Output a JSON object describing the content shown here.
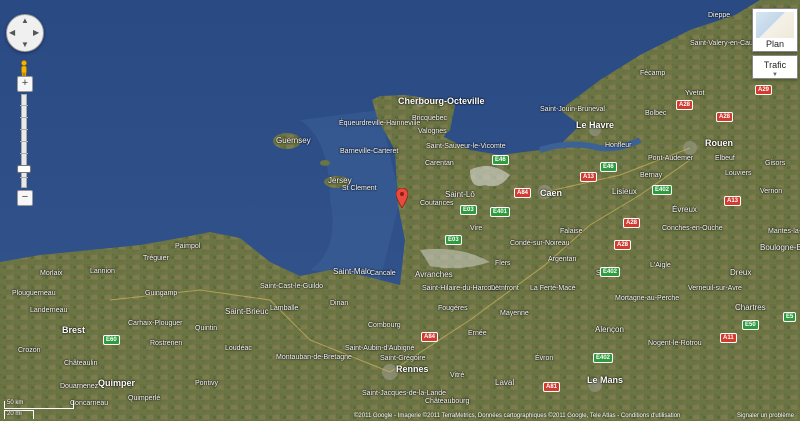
{
  "controls": {
    "pan": {
      "up": "▲",
      "down": "▼",
      "left": "◀",
      "right": "▶"
    },
    "zoom": {
      "in": "+",
      "out": "−"
    },
    "map_type": {
      "label": "Plan"
    },
    "layers": {
      "label": "Trafic"
    }
  },
  "scale": {
    "km": "50 km",
    "mi": "20 mi"
  },
  "footer": {
    "copyright": "©2011 Google - Imagerie ©2011 TerraMetrics, Données cartographiques ©2011 Google, Tele Atlas - Conditions d'utilisation",
    "report": "Signaler un problème"
  },
  "map": {
    "type": "satellite",
    "cities": {
      "cherbourg": "Cherbourg-Octeville",
      "le_havre": "Le Havre",
      "caen": "Caen",
      "rouen": "Rouen",
      "saint_malo": "Saint-Malo",
      "saint_brieuc": "Saint-Brieuc",
      "brest": "Brest",
      "quimper": "Quimper",
      "rennes": "Rennes",
      "le_mans": "Le Mans",
      "laval": "Laval",
      "evreux": "Évreux",
      "dreux": "Dreux",
      "chartres": "Chartres",
      "alencon": "Alençon",
      "lisieux": "Lisieux",
      "saint_lo": "Saint-Lô",
      "avranches": "Avranches",
      "guernsey": "Guernsey",
      "jersey": "Jersey",
      "granville": "Granville",
      "dieppe": "Dieppe",
      "bayeux": "Bayeux",
      "cancale": "Cancale",
      "dinan": "Dinan",
      "fougeres": "Fougères",
      "mayenne": "Mayenne",
      "flers": "Flers",
      "argentan": "Argentan",
      "vire": "Vire",
      "coutances": "Coutances",
      "carentan": "Carentan",
      "valognes": "Valognes",
      "barneville": "Barneville-Carteret",
      "bernay": "Bernay",
      "honfleur": "Honfleur",
      "pont_audemer": "Pont-Audemer",
      "yvetot": "Yvetot",
      "fecamp": "Fécamp",
      "bolbec": "Bolbec",
      "vitre": "Vitré",
      "lamballe": "Lamballe",
      "guingamp": "Guingamp",
      "morlaix": "Morlaix",
      "lannion": "Lannion",
      "loudeac": "Loudéac",
      "pontivy": "Pontivy",
      "carhaix": "Carhaix-Plouguer",
      "chateaulin": "Châteaulin",
      "douarnenez": "Douarnenez",
      "landerneau": "Landerneau",
      "combourg": "Combourg",
      "montfort": "Montfort-sur-Meu",
      "saint_meen": "Saint-Méen-le-Grand",
      "mortagne": "Mortagne-au-Perche",
      "nogent": "Nogent-le-Rotrou",
      "verneuil": "Verneuil-sur-Avre",
      "louviers": "Louviers",
      "elbeuf": "Elbeuf",
      "gisors": "Gisors",
      "vernon": "Vernon",
      "mantes": "Mantes-la-Jolie",
      "boulogne": "Boulogne-Billancourt",
      "rambouillet": "Rambouillet",
      "conches": "Conches-en-Ouche",
      "laigle": "L'Aigle",
      "sees": "Sées",
      "falaise": "Falaise",
      "domfront": "Domfront",
      "la_ferte_mace": "La Ferté-Macé",
      "ernee": "Ernée",
      "evron": "Évron",
      "sille": "Sillé-le-Guillaume",
      "mamers": "Mamers",
      "la_ferte_bernard": "La Ferté-Bernard",
      "chateaudun": "Châteaudun",
      "saint_gregoire": "Saint-Grégoire",
      "cesson": "Cesson-Sévigné",
      "bruz": "Bruz",
      "janze": "Janzé",
      "craon": "Craon",
      "sable": "Sablé-sur-Sarthe",
      "la_fleche": "La Flèche",
      "saint_calais": "Saint-Calais",
      "vendome": "Vendôme",
      "quimperle": "Quimperlé",
      "concarneau": "Concarneau",
      "plouguerneau": "Plouguerneau",
      "paimpol": "Paimpol",
      "perros": "Perros-Guirec",
      "treguier": "Tréguier",
      "saint_pol": "Saint-Pol-de-Léon",
      "roscoff": "Roscoff",
      "dinard": "Dinard",
      "saint_cast": "Saint-Cast-le-Guildo",
      "erquy": "Erquy",
      "pleneuf": "Pléneuf-Val-André",
      "saint_quay": "Saint-Quay-Portrieux",
      "bricquebec": "Bricquebec",
      "les_pieux": "Les Pieux",
      "saint_clement": "St Clement",
      "st_helier": "St Helier",
      "tourlaville": "Tourlaville",
      "equeurdreville": "Équeurdreville-Hainneville",
      "saint_sauveur": "Saint-Sauveur-le-Vicomte",
      "lessay": "Lessay",
      "periers": "Périers",
      "villedieu": "Villedieu-les-Poêles",
      "conde": "Condé-sur-Noireau",
      "pont_l_eveque": "Pont-l'Évêque",
      "saint_valery": "Saint-Valery-en-Caux",
      "saint_romain": "Saint-Romain-de-Colbosc",
      "le_neubourg": "Le Neubourg",
      "barentin": "Barentin",
      "montivilliers": "Montivilliers",
      "saint_aubin": "Saint-Aubin-d'Aubigné",
      "montauban": "Montauban-de-Bretagne",
      "quintin": "Quintin",
      "rostrenen": "Rostrenen",
      "uzel": "Uzel",
      "chateaubourg": "Châteaubourg",
      "mordelles": "Mordelles",
      "saint_jacques": "Saint-Jacques-de-la-Lande",
      "vitre2": "La Guerche-de-Bretagne",
      "ballon": "Ballon",
      "bonnetable": "Bonnétable",
      "mer": "Meslay-du-Maine",
      "laval2": "Château-Gontier",
      "crozon": "Crozon",
      "plabennec": "Plabennec",
      "landivisiau": "Landivisiau",
      "lesneven": "Lesneven",
      "guipavas": "Guipavas",
      "plougastel": "Plougastel-Daoulas",
      "chateauneuf": "Châteauneuf-du-Faou",
      "pleyben": "Pleyben",
      "huelgoat": "Huelgoat",
      "plouaret": "Plouaret",
      "belle_isle": "Belle-Isle-en-Terre",
      "callac": "Callac",
      "broons": "Broons",
      "plancoet": "Plancoët",
      "jugon": "Jugon-les-Lacs",
      "tinteniac": "Tinténiac",
      "liffre": "Liffré",
      "saint_aubin_cormier": "Saint-Aubin-du-Cormier",
      "louvigne": "Louvigné-du-Désert",
      "saint_hilaire": "Saint-Hilaire-du-Harcouët",
      "mortain": "Mortain",
      "pontorson": "Pontorson",
      "ducey": "Ducey",
      "torigni": "Torigni-sur-Vire",
      "caumont": "Caumont-l'Éventé",
      "villers": "Villers-Bocage",
      "aunay": "Aunay-sur-Odon",
      "thury": "Thury-Harcourt",
      "dives": "Dives-sur-Mer",
      "cabourg": "Cabourg",
      "trouville": "Trouville-sur-Mer",
      "deauville": "Deauville",
      "livarot": "Livarot",
      "vimoutiers": "Vimoutiers",
      "orbec": "Orbec",
      "gace": "Gacé",
      "ecouche": "Écouché",
      "carrouges": "Carrouges",
      "pre_en_pail": "Pré-en-Pail",
      "bagnoles": "Bagnoles-de-l'Orne",
      "tinchebray": "Tinchebray",
      "saint_pois": "Saint-Pois",
      "gavray": "Gavray",
      "brehal": "Bréhal",
      "montmartin": "Montmartin-sur-Mer",
      "agon": "Agon-Coutainville",
      "canisy": "Canisy",
      "marigny": "Marigny",
      "isigny": "Isigny-sur-Mer",
      "sainte_mere": "Sainte-Mère-Église",
      "montebourg": "Montebourg",
      "saint_vaast": "Saint-Vaast-la-Hougue",
      "barfleur": "Barfleur",
      "saint_pierre": "Saint-Pierre-Église",
      "beaumont": "Beaumont-Hague",
      "flamanville": "Flamanville",
      "portbail": "Portbail",
      "la_haye": "La Haye-du-Puits",
      "sottevast": "Sottevast",
      "lisieux2": "Saint-Pierre-sur-Dives",
      "mezidon": "Mézidon-Canon",
      "troarn": "Troarn",
      "ouistreham": "Ouistreham",
      "courseulles": "Courseulles-sur-Mer",
      "douvres": "Douvres-la-Délivrande",
      "tilly": "Tilly-sur-Seulles",
      "evrecy": "Évrecy",
      "bretteville": "Bretteville-sur-Laize",
      "cintheaux": "Cintheaux",
      "potigny": "Potigny",
      "trun": "Trun",
      "chambois": "Chambois",
      "le_merlerault": "Le Merlerault",
      "courtomer": "Courtomer",
      "le_mele": "Le Mêle-sur-Sarthe",
      "belleme": "Bellême",
      "remalard": "Rémalard",
      "longny": "Longny-au-Perche",
      "moulins": "Moulins-la-Marche",
      "breteuil": "Breteuil",
      "damville": "Damville",
      "saint_andre": "Saint-André-de-l'Eure",
      "pacy": "Pacy-sur-Eure",
      "anet": "Anet",
      "ivry": "Ivry-la-Bataille",
      "nonancourt": "Nonancourt",
      "brezolles": "Brezolles",
      "senonches": "Senonches",
      "chateauneuf_thymerais": "Châteauneuf-en-Thymerais",
      "la_loupe": "La Loupe",
      "courville": "Courville-sur-Eure",
      "illiers": "Illiers-Combray",
      "bonneval": "Bonneval",
      "voves": "Voves",
      "auneau": "Auneau",
      "maintenon": "Maintenon",
      "epernon": "Épernon",
      "nogent_roi": "Nogent-le-Roi",
      "houdan": "Houdan",
      "septeuil": "Septeuil",
      "bonnieres": "Bonnières-sur-Seine",
      "magny": "Magny-en-Vexin",
      "etrepagny": "Étrépagny",
      "lyons": "Lyons-la-Forêt",
      "fleury": "Fleury-sur-Andelle",
      "les_andelys": "Les Andelys",
      "gaillon": "Gaillon",
      "val_de_reuil": "Val-de-Reuil",
      "pont_de_l_arche": "Pont-de-l'Arche",
      "bourgtheroulde": "Bourgtheroulde-Infreville",
      "routot": "Routot",
      "bourg_achard": "Bourg-Achard",
      "brionne": "Brionne",
      "beaumont_le_roger": "Beaumont-le-Roger",
      "broglie": "Broglie",
      "thiberville": "Thiberville",
      "cormeilles": "Cormeilles",
      "beuzeville": "Beuzeville",
      "quillebeuf": "Quillebeuf-sur-Seine",
      "lillebonne": "Lillebonne",
      "caudebec": "Caudebec-en-Caux",
      "duclair": "Duclair",
      "maromme": "Maromme",
      "mont_saint_aignan": "Mont-Saint-Aignan",
      "bois_guillaume": "Bois-Guillaume",
      "darnetal": "Darnétal",
      "franqueville": "Franqueville-Saint-Pierre",
      "boos": "Boos",
      "grand_couronne": "Grand-Couronne",
      "petit_quevilly": "Le Petit-Quevilly",
      "sotteville": "Sotteville-lès-Rouen",
      "saint_etienne_rouvray": "Saint-Étienne-du-Rouvray",
      "oissel": "Oissel",
      "tourville": "Tourville-la-Rivière",
      "cleon": "Cléon",
      "caudebec_elbeuf": "Caudebec-lès-Elbeuf",
      "saint_pierre_elbeuf": "Saint-Pierre-lès-Elbeuf",
      "criquebeuf": "Criquebeuf-sur-Seine",
      "pitres": "Pîtres",
      "romilly": "Romilly-sur-Andelle",
      "pont_saint_pierre": "Pont-Saint-Pierre",
      "radepont": "Radepont",
      "ecouis": "Écouis",
      "gamaches": "Gamaches",
      "blangy": "Blangy-sur-Bresle",
      "aumale": "Aumale",
      "forges": "Forges-les-Eaux",
      "gournay": "Gournay-en-Bray",
      "neufchatel": "Neufchâtel-en-Bray",
      "saint_saens": "Saint-Saëns",
      "buchy": "Buchy",
      "clères": "Clères",
      "totes": "Tôtes",
      "auffay": "Auffay",
      "longueville": "Longueville-sur-Scie",
      "envermeu": "Envermeu",
      "eu": "Eu",
      "le_treport": "Le Tréport",
      "criel": "Criel-sur-Mer",
      "cany": "Cany-Barville",
      "doudeville": "Doudeville",
      "fontaine": "Fontaine-le-Dun",
      "bacqueville": "Bacqueville-en-Caux",
      "ourville": "Ourville-en-Caux",
      "valmont": "Valmont",
      "goderville": "Goderville",
      "criquetot": "Criquetot-l'Esneval",
      "etretat": "Étretat",
      "saint_jouin": "Saint-Jouin-Bruneval",
      "octeville": "Octeville-sur-Mer",
      "harfleur": "Harfleur",
      "gonfreville": "Gonfreville-l'Orcher",
      "saint_vigor": "Saint-Vigor-d'Ymonville",
      "tancarville": "Tancarville",
      "notre_dame": "Notre-Dame-de-Gravenchon",
      "saint_wandrille": "Saint-Wandrille-Rançon",
      "jumieges": "Jumièges",
      "yainville": "Yainville",
      "le_trait": "Le Trait",
      "anneville": "Anneville-Ambourville",
      "sahurs": "Sahurs",
      "la_bouille": "La Bouille",
      "moulineaux": "Moulineaux",
      "caumont2": "Caumont",
      "la_londe": "La Londe",
      "orival": "Orival",
      "saint_aubin_les_elbeuf": "Saint-Aubin-lès-Elbeuf",
      "freneuse": "Freneuse",
      "sotteville_sous": "Sotteville-sous-le-Val",
      "igoville": "Igoville",
      "alizay": "Alizay",
      "le_manoir": "Le Manoir",
      "les_damps": "Les Damps",
      "poses": "Poses",
      "tournedos": "Tournedos-sur-Seine",
      "porte_joie": "Porte-Joie",
      "muids": "Muids",
      "vatteville": "Vatteville",
      "bernieres": "Bernières-sur-Seine",
      "tosny": "Tosny",
      "courcelles": "Courcelles-sur-Seine",
      "saint_pierre_bailleul": "Saint-Pierre-la-Garenne",
      "villez": "Villez-sous-Bailleul",
      "port_mort": "Port-Mort",
      "notre_dame_isle": "Notre-Dame-de-l'Isle",
      "pressagny": "Pressagny-l'Orgueilleux",
      "saint_marcel": "Saint-Marcel",
      "vernonnet": "Vernonnet",
      "giverny": "Giverny",
      "la_roche": "La Roche-Guyon",
      "vetheuil": "Vétheuil",
      "mantes2": "Mantes-la-Ville",
      "limay": "Limay",
      "porcheville": "Porcheville",
      "gargenville": "Gargenville",
      "meulan": "Meulan-en-Yvelines",
      "les_mureaux": "Les Mureaux",
      "aubergenville": "Aubergenville",
      "epone": "Épône",
      "mezieres": "Mézières-sur-Seine",
      "rosny": "Rosny-sur-Seine",
      "guerville": "Guerville",
      "buchelay": "Buchelay",
      "magnanville": "Magnanville",
      "breval": "Bréval",
      "saint_illiers": "Saint-Illiers-la-Ville",
      "lommoye": "Lommoye",
      "blaru": "Blaru",
      "port_villez": "Port-Villez",
      "jeufosse": "Jeufosse",
      "bennecourt": "Bennecourt",
      "gommecourt": "Gommecourt",
      "limetz": "Limetz-Villez",
      "bonnieres2": "Freneuse",
      "moisson": "Moisson",
      "mousseaux": "Mousseaux-sur-Seine",
      "lavacourt": "Lavacourt",
      "saint_martin_garenne": "Saint-Martin-la-Garenne",
      "dennemont": "Dennemont",
      "follainville": "Follainville-Dennemont",
      "fontenay": "Fontenay-Saint-Père",
      "jumeauville": "Jumeauville",
      "goussonville": "Goussonville",
      "hargeville": "Hargeville",
      "arnouville": "Arnouville-lès-Mantes",
      "boinville": "Boinville-en-Mantois",
      "auffreville": "Auffreville-Brasseuil",
      "vert": "Vert",
      "breuil": "Breuil-Bois-Robert",
      "soindres": "Soindres",
      "favrieux": "Favrieux",
      "flacourt": "Flacourt",
      "dammartin": "Dammartin-en-Serve",
      "longnes": "Longnes",
      "montchauvet": "Montchauvet",
      "tilly2": "Tilly",
      "mondreville": "Mondreville",
      "cravent": "Cravent",
      "chaufour": "Chaufour-lès-Bonnières",
      "perdreauville": "Perdreauville",
      "neauphlette": "Neauphlette",
      "bois_jerome": "Bois-Jérôme-Saint-Ouen",
      "fourges": "Fourges",
      "gasny": "Gasny",
      "sainte_genevieve": "Sainte-Geneviève-lès-Gasny",
      "tourny": "Tourny",
      "dampsmesnil": "Dampsmesnil",
      "aveny": "Aveny",
      "ecos": "Écos",
      "guitry": "Guitry",
      "forêt": "Forêt-la-Folie",
      "cahaignes": "Cahaignes",
      "bus": "Bus-Saint-Rémy",
      "fontenay2": "Fontenay-en-Vexin",
      "mouflaines": "Mouflaines",
      "richeville": "Richeville",
      "hacqueville": "Hacqueville",
      "gamaches2": "Gamaches-en-Vexin",
      "heuqueville": "Heuqueville",
      "ecouis2": "Écouis",
      "saussay": "Saussay-la-Campagne",
      "touffreville": "Touffreville",
      "vandrimare": "Vandrimare",
      "charleval": "Charleval",
      "perriers": "Perriers-sur-Andelle",
      "vascoeuil": "Vascœuil",
      "perruel": "Perruel",
      "lisors": "Lisors",
      "touffreville2": "Touffreville",
      "lorleau": "Lorleau",
      "rosay": "Rosay-sur-Lieure",
      "menesqueville": "Ménesqueville",
      "morgny": "Morgny",
      "le_tronquay": "Le Tronquay",
      "beauficel": "Beauficel-en-Lyons",
      "bezu": "Bézu-la-Forêt",
      "mortemer": "Mortemer",
      "lilly": "Lilly",
      "les_hogues": "Les Hogues",
      "la_feuillie": "La Feuillie",
      "argueil": "Argueil",
      "la_haye_forêt": "La Haye",
      "sigy": "Sigy-en-Bray",
      "nolleval": "Nolléval",
      "elbeuf_sur_andelle": "Elbeuf-sur-Andelle",
      "croisy": "Croisy-sur-Andelle",
      "grainville": "Grainville",
      "bourg_beaudouin": "Bourg-Beaudouin",
      "fresne": "Fresne-le-Plan",
      "mesnil_raoul": "Mesnil-Raoul",
      "saint_aubin_celloville": "Saint-Aubin-Celloville",
      "ymare": "Ymare",
      "gouy": "Gouy",
      "les_authieux": "Les Authieux-sur-le-Port-Saint-Ouen",
      "belbeuf": "Belbeuf",
      "amfreville": "Amfreville-la-Mi-Voie",
      "bonsecours": "Bonsecours",
      "le_mesnil_esnard": "Le Mesnil-Esnard",
      "saint_jacques_darnetal": "Saint-Jacques-sur-Darnétal",
      "saint_leger": "Saint-Léger-du-Bourg-Denis",
      "roncherolles": "Roncherolles-sur-le-Vivier",
      "fontaine_sous": "Fontaine-sous-Préaux",
      "isneauville": "Isneauville",
      "quincampoix": "Quincampoix",
      "bihorel": "Bihorel",
      "saint_martin_vivier": "Saint-Martin-du-Vivier",
      "fontaine_bourg": "Fontaine-le-Bourg",
      "bosc_guerard": "Bosc-Guérard-Saint-Adrien",
      "houppeville": "Houppeville",
      "malaunay": "Malaunay",
      "le_houlme": "Le Houlme",
      "notre_dame_bondeville": "Notre-Dame-de-Bondeville",
      "deville": "Déville-lès-Rouen",
      "canteleu": "Canteleu",
      "saint_pierre_varengeville": "Saint-Pierre-de-Varengeville",
      "hénouville": "Hénouville",
      "quevillon": "Quevillon",
      "saint_martin_boscherville": "Saint-Martin-de-Boscherville",
      "val_de_la_haye": "Val-de-la-Haye",
      "hautot": "Hautot-sur-Seine",
      "grand_quevilly": "Le Grand-Quevilly"
    }
  }
}
